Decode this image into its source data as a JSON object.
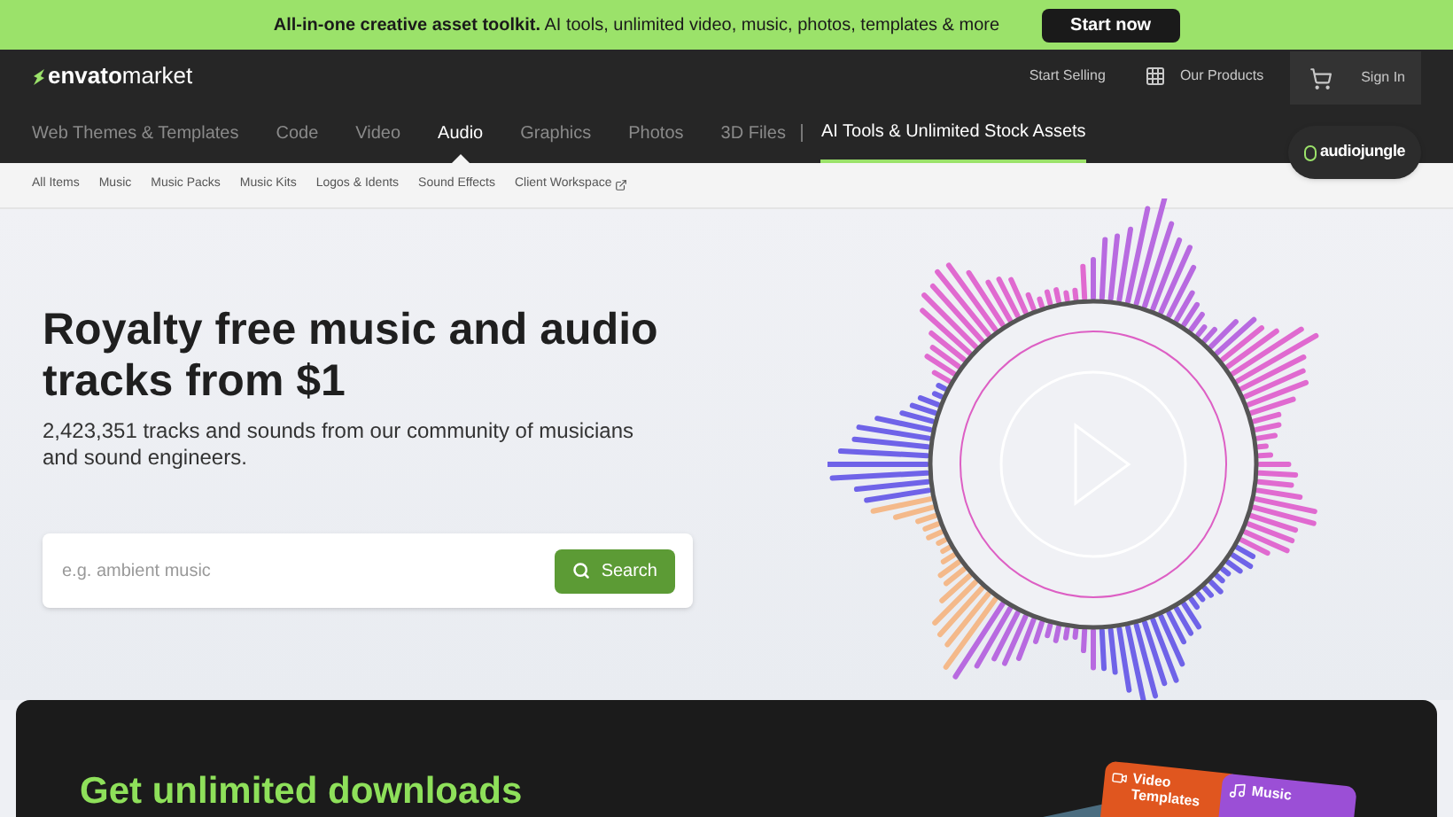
{
  "promo_banner": {
    "text": "**All-in-one creative asset toolkit.** AI tools, unlimited video, music, photos, templates & more",
    "button": "Start now"
  },
  "header": {
    "logo_mark": "envato",
    "logo_text": "market",
    "links": [
      {
        "label": "Start Selling",
        "kind": "text"
      },
      {
        "label": "Our Products",
        "kind": "grid"
      },
      {
        "label": "Sign In",
        "kind": "cart"
      }
    ]
  },
  "main_nav": {
    "items": [
      {
        "label": "Web Themes & Templates",
        "selected": false
      },
      {
        "label": "Code",
        "selected": false
      },
      {
        "label": "Video",
        "selected": false
      },
      {
        "label": "Audio",
        "selected": true
      },
      {
        "label": "Graphics",
        "selected": false
      },
      {
        "label": "Photos",
        "selected": false
      },
      {
        "label": "3D Files",
        "selected": false
      }
    ],
    "highlight": {
      "label": "AI Tools & Unlimited Stock Assets"
    },
    "site_badge": "audiojungle"
  },
  "sub_nav": {
    "items": [
      {
        "label": "All Items",
        "external": false
      },
      {
        "label": "Music",
        "external": false
      },
      {
        "label": "Music Packs",
        "external": false
      },
      {
        "label": "Music Kits",
        "external": false
      },
      {
        "label": "Logos & Idents",
        "external": false
      },
      {
        "label": "Sound Effects",
        "external": false
      },
      {
        "label": "Client Workspace",
        "external": true
      }
    ]
  },
  "hero": {
    "title": "Royalty free music and audio tracks from $1",
    "subtitle": "2,423,351 tracks and sounds from our community of musicians and sound engineers.",
    "search": {
      "placeholder": "e.g. ambient music",
      "button": "Search"
    }
  },
  "promo_card": {
    "heading": "Get unlimited downloads",
    "tiles": [
      {
        "label": "Video Templates",
        "color": "#e0561f"
      },
      {
        "label": "Music",
        "color": "#9b4fd6"
      }
    ]
  }
}
